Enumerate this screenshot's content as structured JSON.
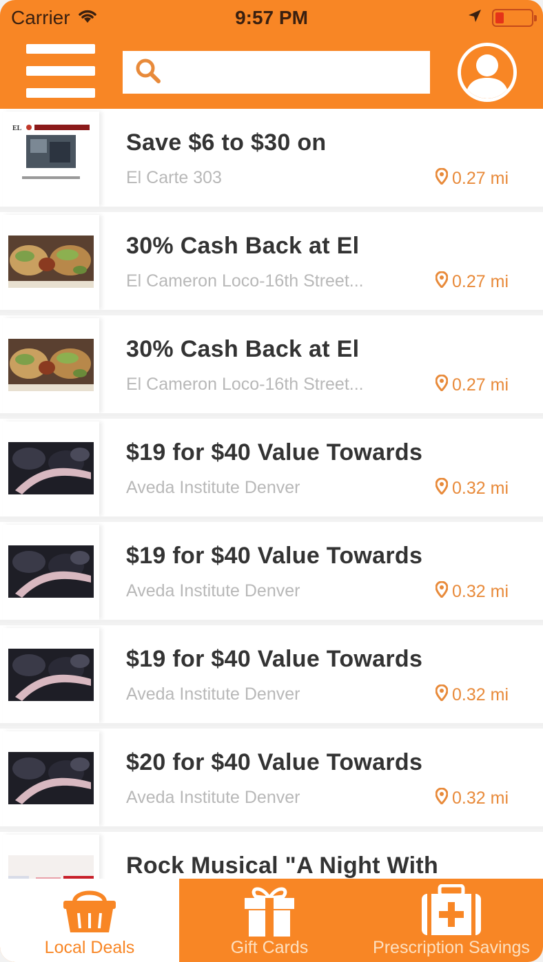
{
  "status_bar": {
    "carrier": "Carrier",
    "time": "9:57 PM",
    "icons": [
      "wifi-icon",
      "location-arrow-icon",
      "battery-low-icon"
    ]
  },
  "nav": {
    "menu_icon": "hamburger-menu-icon",
    "search_icon": "search-icon",
    "search_value": "",
    "profile_icon": "user-avatar-icon"
  },
  "deals": [
    {
      "title": "Save $6 to $30 on",
      "merchant": "El Carte 303",
      "distance": "0.27 mi",
      "thumb": "restaurant-logo"
    },
    {
      "title": "30% Cash Back at El",
      "merchant": "El Cameron Loco-16th Street...",
      "distance": "0.27 mi",
      "thumb": "tacos"
    },
    {
      "title": "30% Cash Back at El",
      "merchant": "El Cameron Loco-16th Street...",
      "distance": "0.27 mi",
      "thumb": "tacos"
    },
    {
      "title": "$19 for $40 Value Towards",
      "merchant": "Aveda Institute Denver",
      "distance": "0.32 mi",
      "thumb": "salon"
    },
    {
      "title": "$19 for $40 Value Towards",
      "merchant": "Aveda Institute Denver",
      "distance": "0.32 mi",
      "thumb": "salon"
    },
    {
      "title": "$19 for $40 Value Towards",
      "merchant": "Aveda Institute Denver",
      "distance": "0.32 mi",
      "thumb": "salon"
    },
    {
      "title": "$20 for $40 Value Towards",
      "merchant": "Aveda Institute Denver",
      "distance": "0.32 mi",
      "thumb": "salon"
    },
    {
      "title": "Rock Musical \"A Night With",
      "merchant": "",
      "distance": "",
      "thumb": "concert"
    }
  ],
  "tabs": [
    {
      "label": "Local Deals",
      "icon": "basket-icon",
      "active": true
    },
    {
      "label": "Gift Cards",
      "icon": "gift-icon",
      "active": false
    },
    {
      "label": "Prescription Savings",
      "icon": "medical-kit-icon",
      "active": false
    }
  ],
  "colors": {
    "brand_orange": "#f88625",
    "distance_orange": "#e88a3a",
    "title_text": "#333333",
    "merchant_text": "#b8b8b8"
  }
}
